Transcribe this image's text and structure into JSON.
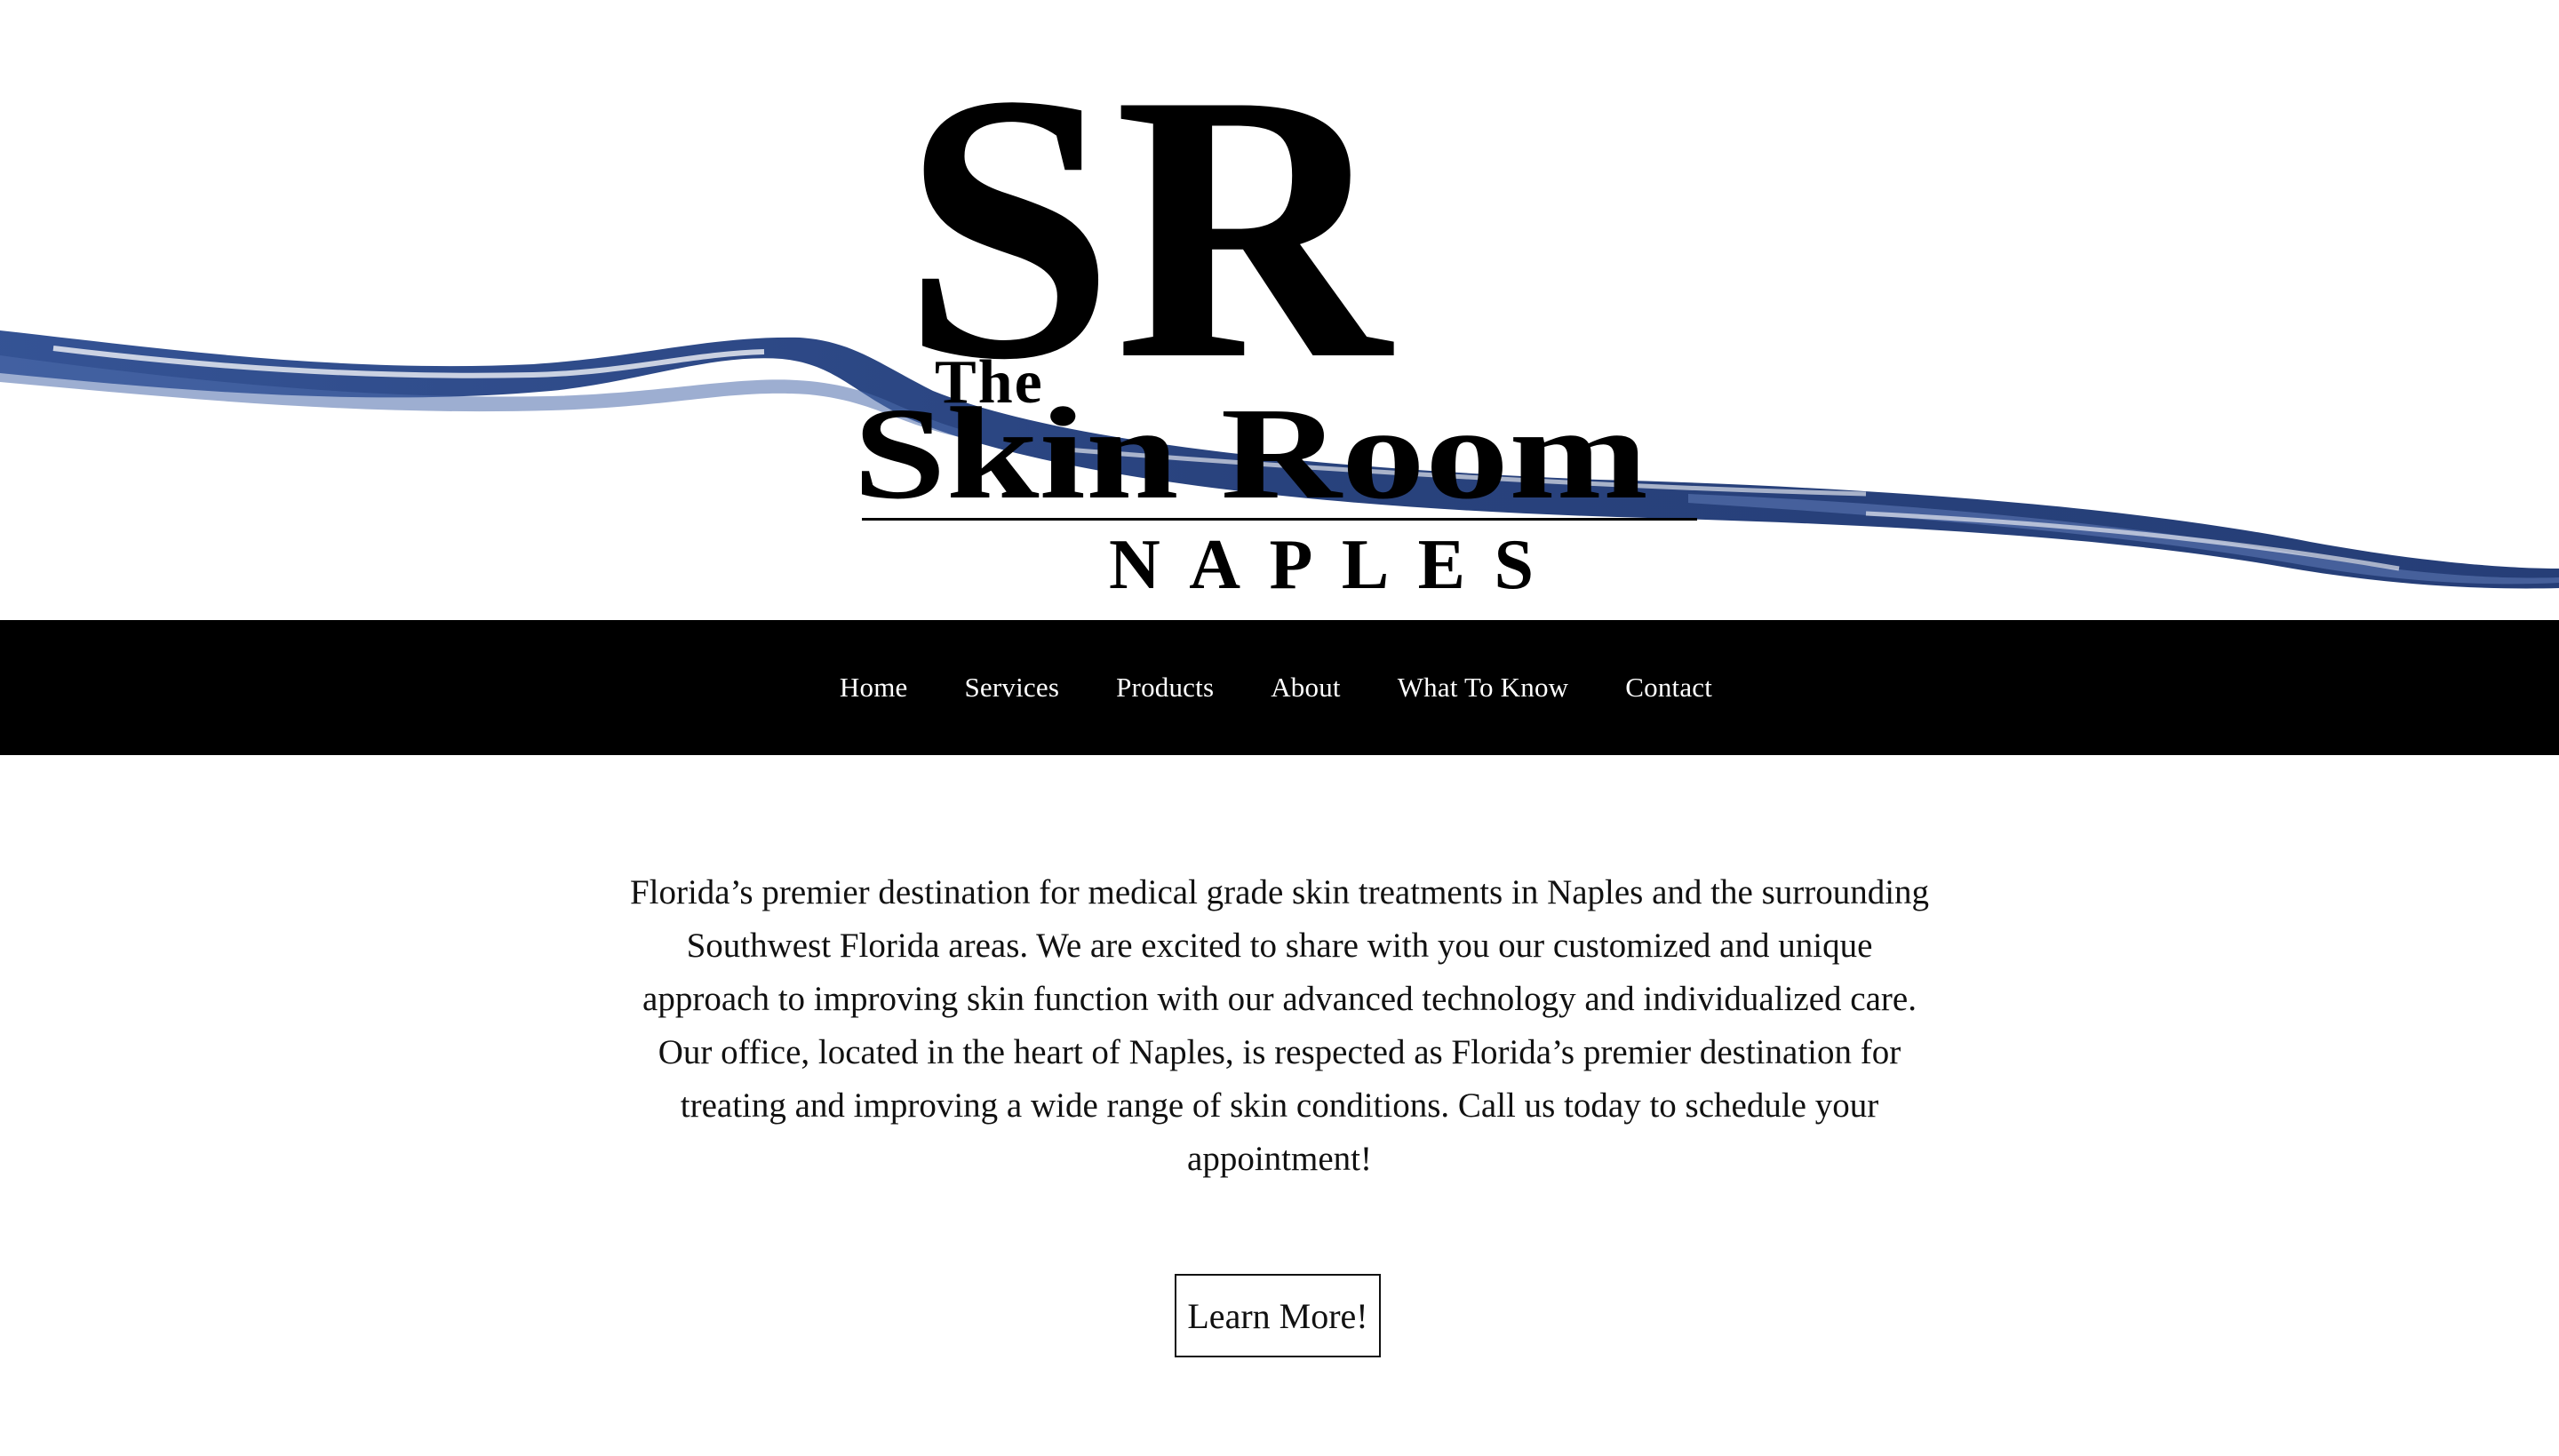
{
  "brand": {
    "monogram": "SR",
    "line_the": "The",
    "line_name": "Skin Room",
    "line_city": "NAPLES",
    "wave_color": "#1f3a7a"
  },
  "nav": {
    "items": [
      {
        "label": "Home"
      },
      {
        "label": "Services"
      },
      {
        "label": "Products"
      },
      {
        "label": "About"
      },
      {
        "label": "What To Know"
      },
      {
        "label": "Contact"
      }
    ]
  },
  "main": {
    "intro_text": "Florida’s premier destination for medical grade skin treatments in Naples and the surrounding Southwest Florida areas. We are excited to share with you our customized and unique approach to improving skin function with our advanced technology and individualized care. Our office, located in the heart of Naples, is respected as Florida’s premier destination for treating and improving a wide range of skin conditions. Call us today to schedule your appointment!",
    "cta_label": "Learn More!"
  }
}
